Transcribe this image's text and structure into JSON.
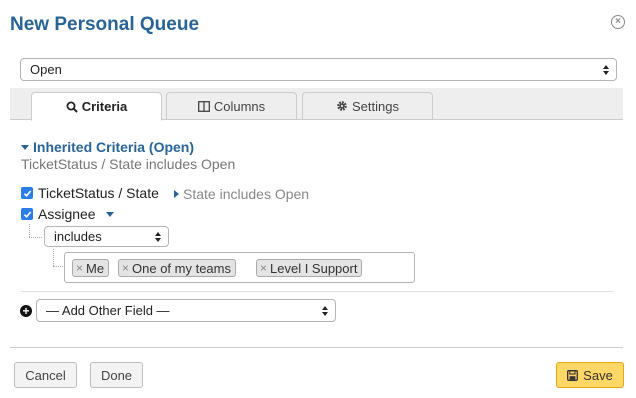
{
  "dialog": {
    "title": "New Personal Queue",
    "close_icon": "close-icon"
  },
  "queue_select": {
    "value": "Open"
  },
  "tabs": [
    {
      "label": "Criteria",
      "icon": "search-icon",
      "active": true
    },
    {
      "label": "Columns",
      "icon": "columns-icon",
      "active": false
    },
    {
      "label": "Settings",
      "icon": "gear-icon",
      "active": false
    }
  ],
  "inherited": {
    "heading": "Inherited Criteria (Open)",
    "summary": "TicketStatus / State includes Open"
  },
  "criteria": {
    "ticket_status": {
      "label": "TicketStatus / State",
      "condition": "State includes Open",
      "checked": true
    },
    "assignee": {
      "label": "Assignee",
      "checked": true,
      "operator": "includes",
      "values": [
        "Me",
        "One of my teams",
        "Level I Support"
      ]
    }
  },
  "add_field": {
    "value": "— Add Other Field —"
  },
  "footer": {
    "cancel_label": "Cancel",
    "done_label": "Done",
    "save_label": "Save"
  },
  "colors": {
    "accent": "#2a6496",
    "checkbox": "#2b7de9",
    "save_bg": "#ffd766",
    "save_border": "#e6a817"
  }
}
